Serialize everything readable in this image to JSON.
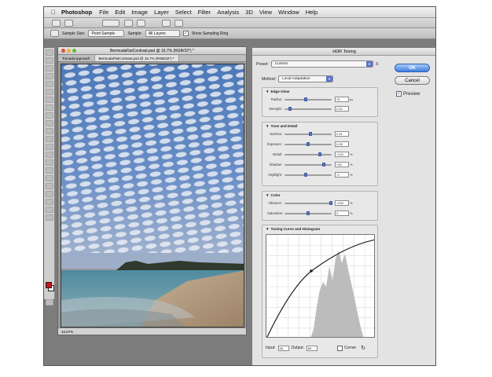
{
  "menu": {
    "app": "Photoshop",
    "items": [
      "File",
      "Edit",
      "Image",
      "Layer",
      "Select",
      "Filter",
      "Analysis",
      "3D",
      "View",
      "Window",
      "Help"
    ]
  },
  "tool_options": {
    "sample_size_label": "Sample Size:",
    "sample_size_value": "Point Sample",
    "sample_label": "Sample:",
    "sample_value": "All Layers",
    "show_sampling_ring": "Show Sampling Ring"
  },
  "document": {
    "title": "BermudaFlatContrast.psd @ 16.7% (RGB/32*) *",
    "tabs": [
      "TornadoApproach",
      "BermudaFlatContrast.psd @ 16.7% (RGB/32*) *"
    ],
    "zoom": "16.67%"
  },
  "dialog": {
    "title": "HDR Toning",
    "preset_label": "Preset:",
    "preset_value": "Custom",
    "method_label": "Method:",
    "method_value": "Local Adaptation",
    "ok": "OK",
    "cancel": "Cancel",
    "preview": "Preview",
    "edge_glow": {
      "title": "Edge Glow",
      "radius_label": "Radius:",
      "radius_value": "75",
      "radius_unit": "px",
      "radius_pos": 0.45,
      "strength_label": "Strength:",
      "strength_value": "0.52",
      "strength_pos": 0.12
    },
    "tone_detail": {
      "title": "Tone and Detail",
      "gamma_label": "Gamma:",
      "gamma_value": "0.51",
      "gamma_pos": 0.55,
      "exposure_label": "Exposure:",
      "exposure_value": "0.08",
      "exposure_pos": 0.5,
      "detail_label": "Detail:",
      "detail_value": "+100",
      "detail_unit": "%",
      "detail_pos": 0.75,
      "shadow_label": "Shadow:",
      "shadow_value": "+83",
      "shadow_unit": "%",
      "shadow_pos": 0.83,
      "highlight_label": "Highlight:",
      "highlight_value": "-9",
      "highlight_unit": "%",
      "highlight_pos": 0.45
    },
    "color": {
      "title": "Color",
      "vibrance_label": "Vibrance:",
      "vibrance_value": "+100",
      "vibrance_unit": "%",
      "vibrance_pos": 0.98,
      "saturation_label": "Saturation:",
      "saturation_value": "0",
      "saturation_unit": "%",
      "saturation_pos": 0.5
    },
    "curve": {
      "title": "Toning Curve and Histogram",
      "input_label": "Input:",
      "input_value": "36",
      "output_label": "Output:",
      "output_value": "60",
      "corner_label": "Corner"
    }
  },
  "colors": {
    "accent": "#3d7fe4",
    "foreground_swatch": "#c8141a"
  }
}
